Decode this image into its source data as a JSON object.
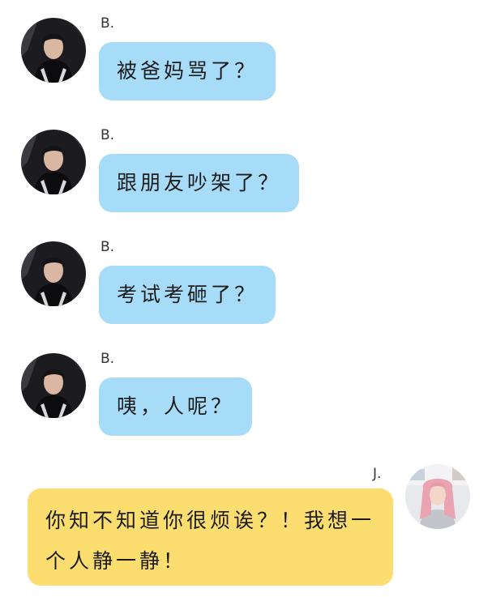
{
  "messages": [
    {
      "sender": "B.",
      "text": "被爸妈骂了？",
      "side": "left",
      "bubble_color": "#a7dcf8"
    },
    {
      "sender": "B.",
      "text": "跟朋友吵架了？",
      "side": "left",
      "bubble_color": "#a7dcf8"
    },
    {
      "sender": "B.",
      "text": "考试考砸了？",
      "side": "left",
      "bubble_color": "#a7dcf8"
    },
    {
      "sender": "B.",
      "text": "咦，人呢？",
      "side": "left",
      "bubble_color": "#a7dcf8"
    },
    {
      "sender": "J.",
      "text": "你知不知道你很烦诶？！我想一个人静一静！",
      "side": "right",
      "bubble_color": "#fbde6f"
    }
  ]
}
